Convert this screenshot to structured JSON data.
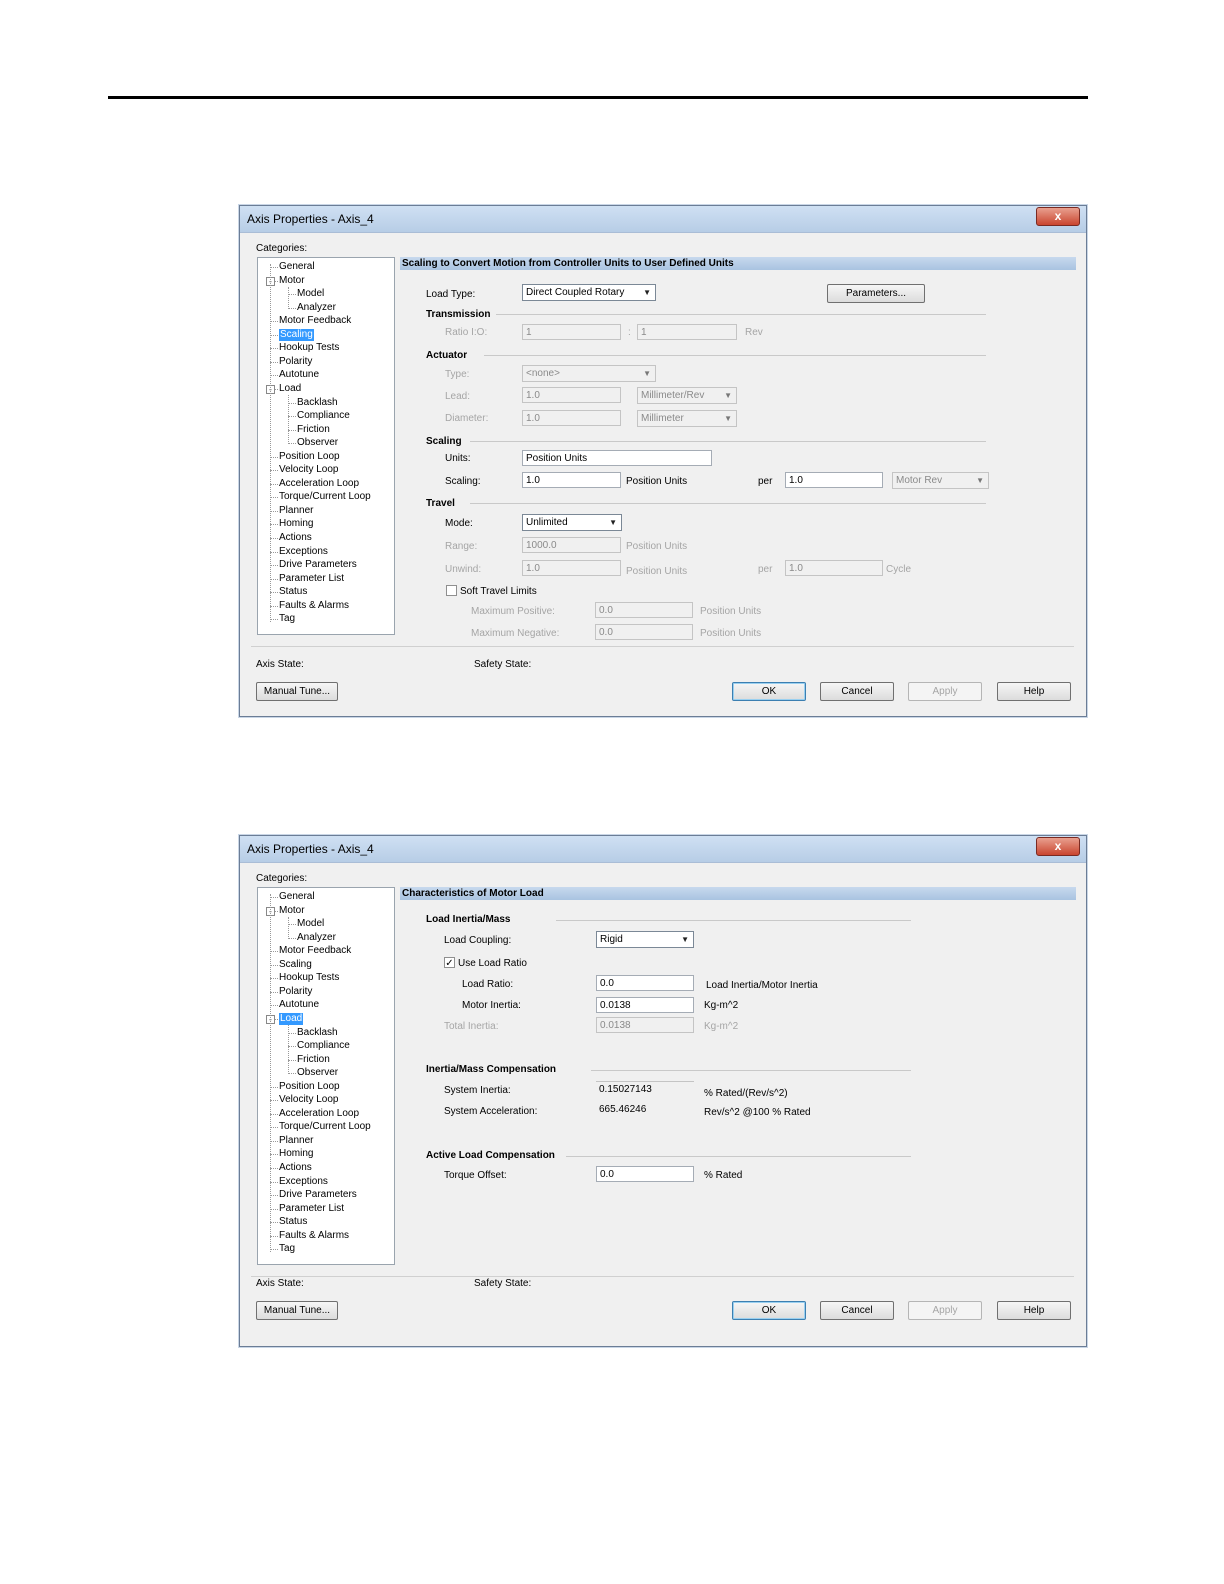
{
  "dialog1": {
    "title": "Axis Properties - Axis_4",
    "close_label": "x",
    "categories_label": "Categories:",
    "header": "Scaling to Convert Motion from Controller Units to User Defined Units",
    "load_type_label": "Load Type:",
    "load_type_value": "Direct Coupled Rotary",
    "parameters_button": "Parameters...",
    "transmission_label": "Transmission",
    "ratio_label": "Ratio I:O:",
    "ratio_in": "1",
    "ratio_sep": ":",
    "ratio_out": "1",
    "ratio_unit": "Rev",
    "actuator_label": "Actuator",
    "type_label": "Type:",
    "type_value": "<none>",
    "lead_label": "Lead:",
    "lead_value": "1.0",
    "lead_unit": "Millimeter/Rev",
    "diameter_label": "Diameter:",
    "diameter_value": "1.0",
    "diameter_unit": "Millimeter",
    "scaling_label": "Scaling",
    "units_label": "Units:",
    "units_value": "Position Units",
    "scaling_field_label": "Scaling:",
    "scaling_value": "1.0",
    "scaling_unit": "Position Units",
    "per_label": "per",
    "per_value": "1.0",
    "per_unit": "Motor Rev",
    "travel_label": "Travel",
    "mode_label": "Mode:",
    "mode_value": "Unlimited",
    "range_label": "Range:",
    "range_value": "1000.0",
    "range_unit": "Position Units",
    "unwind_label": "Unwind:",
    "unwind_value": "1.0",
    "unwind_unit": "Position Units",
    "unwind_per_label": "per",
    "unwind_per_value": "1.0",
    "unwind_per_unit": "Cycle",
    "soft_travel_label": "Soft Travel Limits",
    "soft_travel_checked": false,
    "max_pos_label": "Maximum Positive:",
    "max_pos_value": "0.0",
    "max_pos_unit": "Position Units",
    "max_neg_label": "Maximum Negative:",
    "max_neg_value": "0.0",
    "max_neg_unit": "Position Units",
    "axis_state_label": "Axis State:",
    "safety_state_label": "Safety State:",
    "manual_tune_button": "Manual Tune...",
    "ok_button": "OK",
    "cancel_button": "Cancel",
    "apply_button": "Apply",
    "help_button": "Help",
    "selected_category": "Scaling"
  },
  "dialog2": {
    "title": "Axis Properties - Axis_4",
    "close_label": "x",
    "categories_label": "Categories:",
    "header": "Characteristics of Motor Load",
    "inertia_section": "Load Inertia/Mass",
    "load_coupling_label": "Load Coupling:",
    "load_coupling_value": "Rigid",
    "use_load_ratio_label": "Use Load Ratio",
    "use_load_ratio_checked": true,
    "load_ratio_label": "Load Ratio:",
    "load_ratio_value": "0.0",
    "load_ratio_unit": "Load Inertia/Motor Inertia",
    "motor_inertia_label": "Motor Inertia:",
    "motor_inertia_value": "0.0138",
    "motor_inertia_unit": "Kg-m^2",
    "total_inertia_label": "Total Inertia:",
    "total_inertia_value": "0.0138",
    "total_inertia_unit": "Kg-m^2",
    "compensation_section": "Inertia/Mass Compensation",
    "system_inertia_label": "System Inertia:",
    "system_inertia_value": "0.15027143",
    "system_inertia_unit": "% Rated/(Rev/s^2)",
    "system_accel_label": "System Acceleration:",
    "system_accel_value": "665.46246",
    "system_accel_unit": "Rev/s^2 @100 % Rated",
    "active_section": "Active Load Compensation",
    "torque_offset_label": "Torque Offset:",
    "torque_offset_value": "0.0",
    "torque_offset_unit": "% Rated",
    "axis_state_label": "Axis State:",
    "safety_state_label": "Safety State:",
    "manual_tune_button": "Manual Tune...",
    "ok_button": "OK",
    "cancel_button": "Cancel",
    "apply_button": "Apply",
    "help_button": "Help",
    "selected_category": "Load"
  },
  "tree": [
    {
      "label": "General",
      "level": 0
    },
    {
      "label": "Motor",
      "level": 0,
      "expander": "-"
    },
    {
      "label": "Model",
      "level": 1
    },
    {
      "label": "Analyzer",
      "level": 1
    },
    {
      "label": "Motor Feedback",
      "level": 0
    },
    {
      "label": "Scaling",
      "level": 0
    },
    {
      "label": "Hookup Tests",
      "level": 0
    },
    {
      "label": "Polarity",
      "level": 0
    },
    {
      "label": "Autotune",
      "level": 0
    },
    {
      "label": "Load",
      "level": 0,
      "expander": "-"
    },
    {
      "label": "Backlash",
      "level": 1
    },
    {
      "label": "Compliance",
      "level": 1
    },
    {
      "label": "Friction",
      "level": 1
    },
    {
      "label": "Observer",
      "level": 1
    },
    {
      "label": "Position Loop",
      "level": 0
    },
    {
      "label": "Velocity Loop",
      "level": 0
    },
    {
      "label": "Acceleration Loop",
      "level": 0
    },
    {
      "label": "Torque/Current Loop",
      "level": 0
    },
    {
      "label": "Planner",
      "level": 0
    },
    {
      "label": "Homing",
      "level": 0
    },
    {
      "label": "Actions",
      "level": 0
    },
    {
      "label": "Exceptions",
      "level": 0
    },
    {
      "label": "Drive Parameters",
      "level": 0
    },
    {
      "label": "Parameter List",
      "level": 0
    },
    {
      "label": "Status",
      "level": 0
    },
    {
      "label": "Faults & Alarms",
      "level": 0
    },
    {
      "label": "Tag",
      "level": 0
    }
  ]
}
